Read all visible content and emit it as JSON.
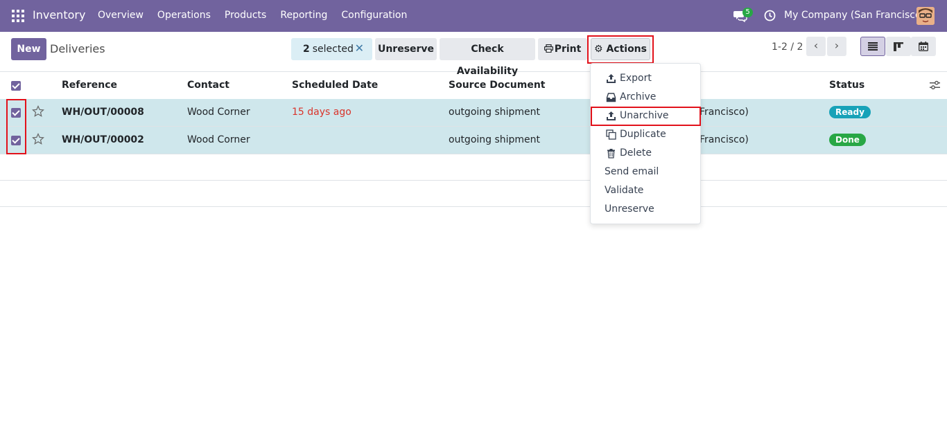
{
  "navbar": {
    "app_name": "Inventory",
    "menu": [
      "Overview",
      "Operations",
      "Products",
      "Reporting",
      "Configuration"
    ],
    "chat_count": "5",
    "company": "My Company (San Francisco)"
  },
  "control": {
    "new_label": "New",
    "breadcrumb": "Deliveries",
    "selected_count": "2",
    "selected_label": "selected",
    "unreserve_label": "Unreserve",
    "check_label": "Check Availability",
    "print_label": "Print",
    "actions_label": "Actions",
    "pager": "1-2 / 2"
  },
  "table": {
    "headers": {
      "reference": "Reference",
      "contact": "Contact",
      "scheduled": "Scheduled Date",
      "source": "Source Document",
      "status": "Status"
    },
    "rows": [
      {
        "reference": "WH/OUT/00008",
        "contact": "Wood Corner",
        "scheduled": "15 days ago",
        "source": "outgoing shipment",
        "warehouse": "Francisco)",
        "status": "Ready"
      },
      {
        "reference": "WH/OUT/00002",
        "contact": "Wood Corner",
        "scheduled": "",
        "source": "outgoing shipment",
        "warehouse": "Francisco)",
        "status": "Done"
      }
    ]
  },
  "actions_menu": {
    "items": [
      "Export",
      "Archive",
      "Unarchive",
      "Duplicate",
      "Delete",
      "Send email",
      "Validate",
      "Unreserve"
    ]
  },
  "colors": {
    "brand": "#71639e",
    "selected_row": "#cfe7ec",
    "ready": "#17a2b8",
    "done": "#28a745",
    "highlight": "#e2111a"
  }
}
